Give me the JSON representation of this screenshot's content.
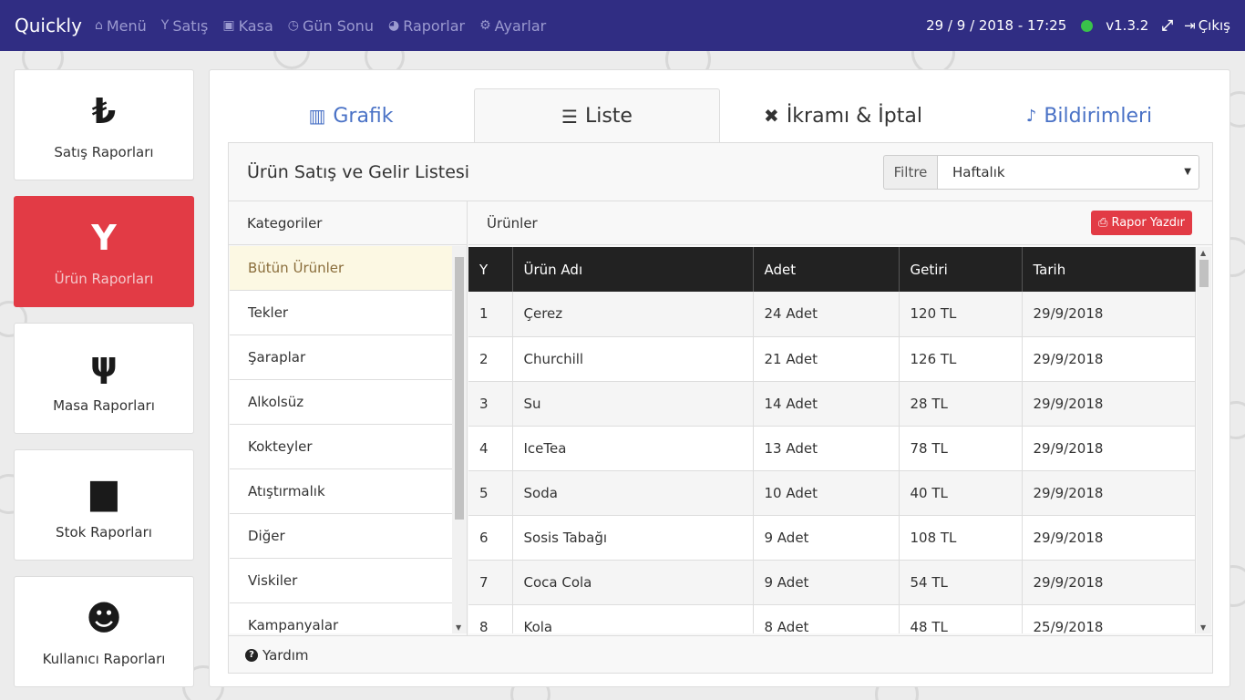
{
  "app": {
    "brand": "Quickly"
  },
  "nav": [
    {
      "icon": "home-icon",
      "glyph": "⌂",
      "label": "Menü"
    },
    {
      "icon": "cocktail-icon",
      "glyph": "Y",
      "label": "Satış"
    },
    {
      "icon": "cash-icon",
      "glyph": "▣",
      "label": "Kasa"
    },
    {
      "icon": "clock-icon",
      "glyph": "◷",
      "label": "Gün Sonu"
    },
    {
      "icon": "pie-chart-icon",
      "glyph": "◕",
      "label": "Raporlar"
    },
    {
      "icon": "gears-icon",
      "glyph": "⚙",
      "label": "Ayarlar"
    }
  ],
  "status": {
    "datetime": "29 / 9 / 2018 - 17:25",
    "version": "v1.3.2",
    "logout_label": "Çıkış"
  },
  "side": [
    {
      "icon": "lira-icon",
      "glyph": "₺",
      "label": "Satış Raporları",
      "active": false
    },
    {
      "icon": "cocktail-icon",
      "glyph": "Y",
      "label": "Ürün Raporları",
      "active": true
    },
    {
      "icon": "cutlery-icon",
      "glyph": "ψ",
      "label": "Masa Raporları",
      "active": false
    },
    {
      "icon": "truck-icon",
      "glyph": "▆",
      "label": "Stok Raporları",
      "active": false
    },
    {
      "icon": "users-icon",
      "glyph": "☻",
      "label": "Kullanıcı Raporları",
      "active": false
    }
  ],
  "tabs": [
    {
      "icon": "bar-chart-icon",
      "glyph": "▥",
      "label": "Grafik"
    },
    {
      "icon": "list-icon",
      "glyph": "☰",
      "label": "Liste"
    },
    {
      "icon": "close-icon",
      "glyph": "✖",
      "label": "İkramı & İptal"
    },
    {
      "icon": "bell-icon",
      "glyph": "🔔",
      "label": "Bildirimleri"
    }
  ],
  "content": {
    "title": "Ürün Satış ve Gelir Listesi",
    "filter_label": "Filtre",
    "filter_value": "Haftalık"
  },
  "categories": {
    "header": "Kategoriler",
    "items": [
      "Bütün Ürünler",
      "Tekler",
      "Şaraplar",
      "Alkolsüz",
      "Kokteyler",
      "Atıştırmalık",
      "Diğer",
      "Viskiler",
      "Kampanyalar"
    ]
  },
  "products": {
    "header": "Ürünler",
    "print_label": "Rapor Yazdır",
    "columns": [
      "",
      "Ürün Adı",
      "Adet",
      "Getiri",
      "Tarih"
    ],
    "rows": [
      [
        "1",
        "Çerez",
        "24 Adet",
        "120 TL",
        "29/9/2018"
      ],
      [
        "2",
        "Churchill",
        "21 Adet",
        "126 TL",
        "29/9/2018"
      ],
      [
        "3",
        "Su",
        "14 Adet",
        "28 TL",
        "29/9/2018"
      ],
      [
        "4",
        "IceTea",
        "13 Adet",
        "78 TL",
        "29/9/2018"
      ],
      [
        "5",
        "Soda",
        "10 Adet",
        "40 TL",
        "29/9/2018"
      ],
      [
        "6",
        "Sosis Tabağı",
        "9 Adet",
        "108 TL",
        "29/9/2018"
      ],
      [
        "7",
        "Coca Cola",
        "9 Adet",
        "54 TL",
        "29/9/2018"
      ],
      [
        "8",
        "Kola",
        "8 Adet",
        "48 TL",
        "25/9/2018"
      ]
    ]
  },
  "help": {
    "label": "Yardım"
  },
  "colors": {
    "navbar": "#302d83",
    "active_card": "#e23b45",
    "accent": "#4a72c6",
    "status_online": "#39c24b"
  }
}
